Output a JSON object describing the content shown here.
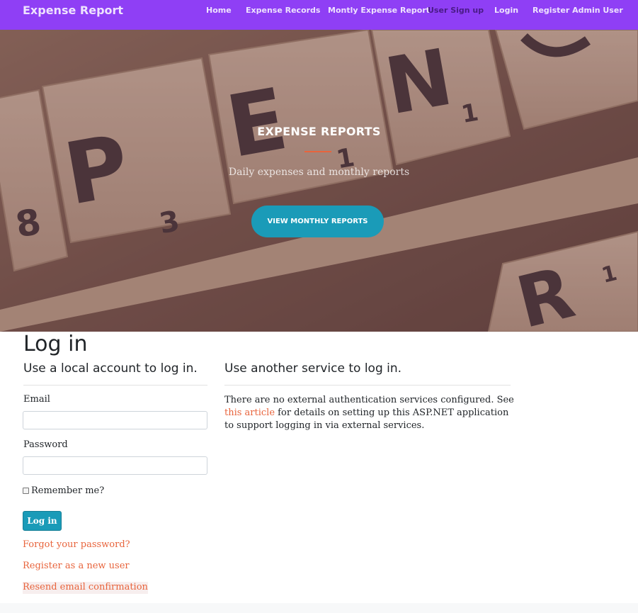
{
  "navbar": {
    "brand": "Expense Report",
    "links": [
      {
        "label": "Home"
      },
      {
        "label": "Expense Records"
      },
      {
        "label": "Montly Expense Report"
      },
      {
        "label": "User Sign up"
      },
      {
        "label": "Login"
      },
      {
        "label": "Register Admin User"
      }
    ],
    "bg_color": "#8f3ff5"
  },
  "hero": {
    "title": "EXPENSE REPORTS",
    "subtitle": "Daily expenses and monthly reports",
    "button_label": "VIEW MONTHLY REPORTS",
    "accent_color": "#e8643c",
    "button_color": "#1a9bb8",
    "tiles": [
      {
        "letter": "P",
        "sub": "3"
      },
      {
        "letter": "E",
        "sub": "1"
      },
      {
        "letter": "N",
        "sub": "1"
      },
      {
        "letter": "R",
        "sub": "1"
      },
      {
        "letter": "",
        "sub": "8"
      }
    ]
  },
  "login": {
    "title": "Log in",
    "local_heading": "Use a local account to log in.",
    "email_label": "Email",
    "email_value": "",
    "password_label": "Password",
    "password_value": "",
    "remember_label": "Remember me?",
    "remember_checked": false,
    "submit_label": "Log in",
    "forgot_link": "Forgot your password?",
    "register_link": "Register as a new user",
    "resend_link": "Resend email confirmation"
  },
  "external": {
    "heading": "Use another service to log in.",
    "text_before": "There are no external authentication services configured. See ",
    "link_text": "this article",
    "text_after": " for details on setting up this ASP.NET application to support logging in via external services."
  }
}
